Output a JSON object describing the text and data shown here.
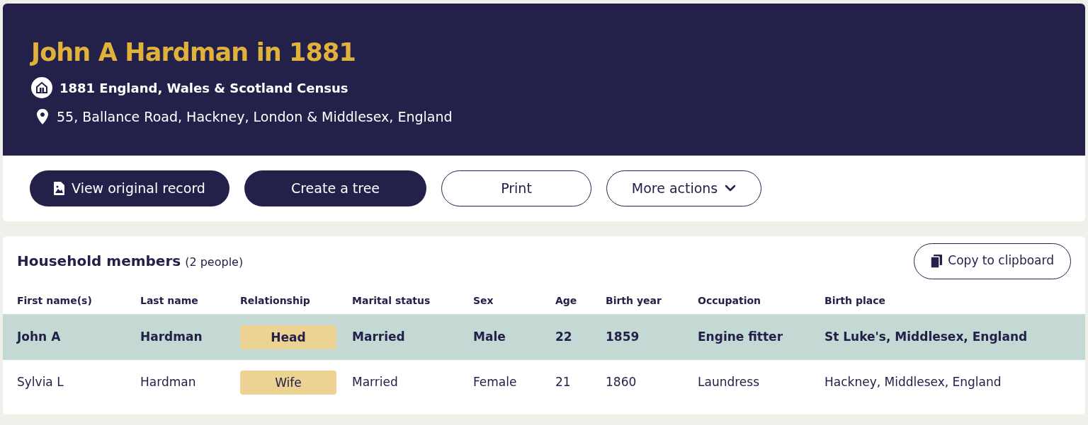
{
  "record": {
    "title": "John A Hardman in 1881",
    "collection": "1881 England, Wales & Scotland Census",
    "address": "55, Ballance Road, Hackney, London & Middlesex, England"
  },
  "actions": [
    {
      "label": "View original record",
      "kind": "primary-icon"
    },
    {
      "label": "Create a tree",
      "kind": "primary"
    },
    {
      "label": "Print",
      "kind": "outline"
    },
    {
      "label": "More actions",
      "kind": "dropdown"
    }
  ],
  "household": {
    "title": "Household members",
    "count": "(2 people)",
    "copy_button": "Copy to clipboard",
    "columns": [
      "First name(s)",
      "Last name",
      "Relationship",
      "Marital status",
      "Sex",
      "Age",
      "Birth year",
      "Occupation",
      "Birth place"
    ],
    "rows": [
      {
        "selected": true,
        "cells": [
          "John A",
          "Hardman",
          "Head",
          "Married",
          "Male",
          "22",
          "1859",
          "Engine fitter",
          "St Luke's, Middlesex, England"
        ]
      },
      {
        "selected": false,
        "cells": [
          "Sylvia L",
          "Hardman",
          "Wife",
          "Married",
          "Female",
          "21",
          "1860",
          "Laundress",
          "Hackney, Middlesex, England"
        ]
      }
    ]
  }
}
